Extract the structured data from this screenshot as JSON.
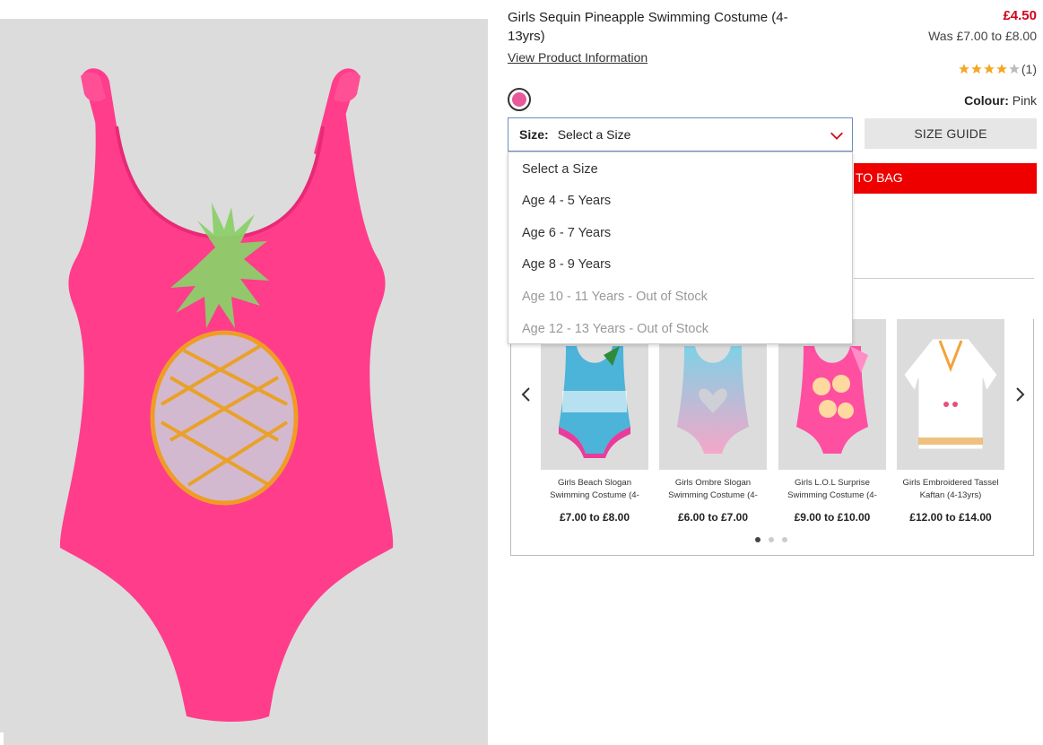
{
  "product": {
    "title": "Girls Sequin Pineapple Swimming Costume (4-13yrs)",
    "view_info": "View Product Information",
    "price": "£4.50",
    "was_price": "Was £7.00 to £8.00",
    "rating": 4,
    "rating_count": "(1)",
    "colour_label": "Colour:",
    "colour_value": "Pink",
    "swatch_color": "#e6599a"
  },
  "size": {
    "label": "Size:",
    "selected": "Select a Size",
    "size_guide": "SIZE GUIDE",
    "add_to_bag": "TO BAG",
    "options": [
      {
        "label": "Select a Size",
        "out_of_stock": false
      },
      {
        "label": "Age 4 - 5 Years",
        "out_of_stock": false
      },
      {
        "label": "Age 6 - 7 Years",
        "out_of_stock": false
      },
      {
        "label": "Age 8 - 9 Years",
        "out_of_stock": false
      },
      {
        "label": "Age 10 - 11 Years - Out of Stock",
        "out_of_stock": true
      },
      {
        "label": "Age 12 - 13 Years - Out of Stock",
        "out_of_stock": true
      }
    ]
  },
  "carousel": {
    "items": [
      {
        "name": "Girls Beach Slogan Swimming Costume (4-",
        "price": "£7.00 to £8.00"
      },
      {
        "name": "Girls Ombre Slogan Swimming Costume (4-",
        "price": "£6.00 to £7.00"
      },
      {
        "name": "Girls L.O.L Surprise Swimming Costume (4-",
        "price": "£9.00 to £10.00"
      },
      {
        "name": "Girls Embroidered Tassel Kaftan (4-13yrs)",
        "price": "£12.00 to £14.00"
      }
    ],
    "active_page": 1,
    "page_count": 3
  },
  "colors": {
    "accent_red": "#e00000",
    "price_red": "#d0021b",
    "star": "#f5a623"
  }
}
